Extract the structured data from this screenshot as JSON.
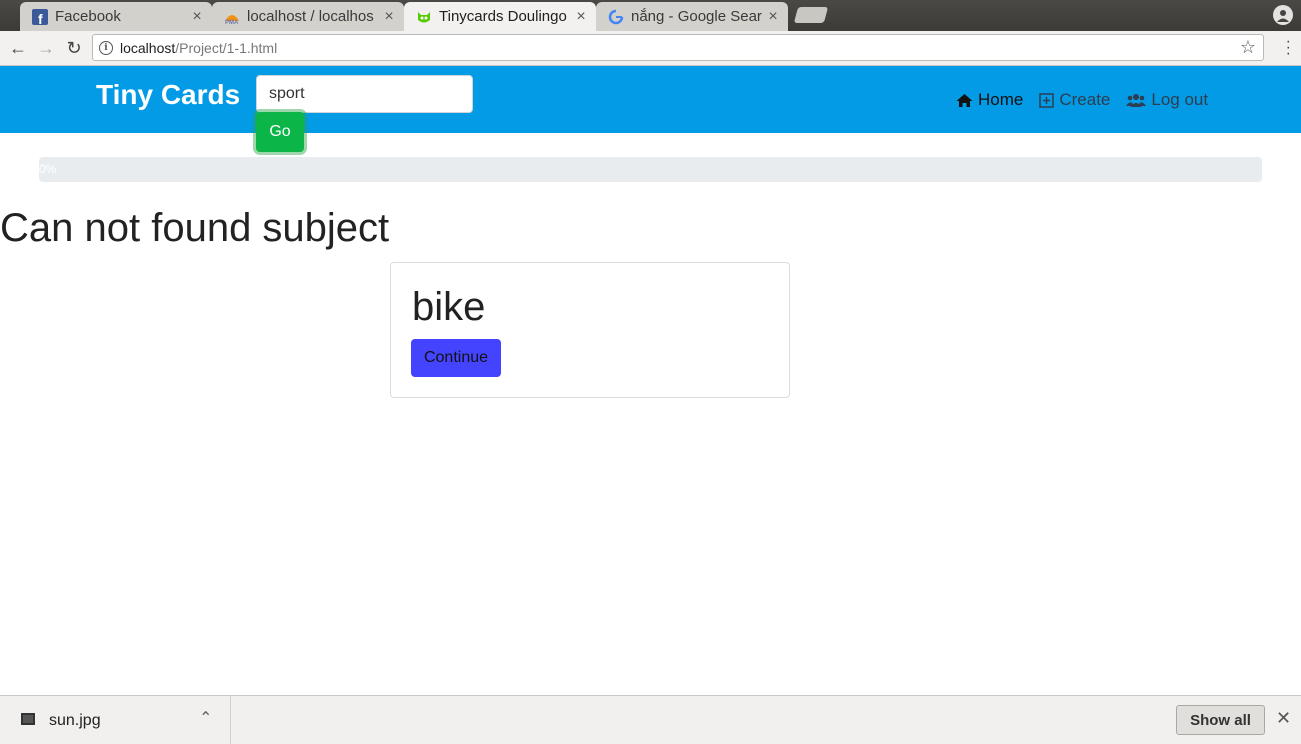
{
  "browser": {
    "tabs": [
      {
        "title": "Facebook",
        "icon": "facebook-icon",
        "active": false
      },
      {
        "title": "localhost / localhos",
        "icon": "phpmyadmin-icon",
        "active": false
      },
      {
        "title": "Tinycards Doulingo",
        "icon": "duolingo-owl-icon",
        "active": true
      },
      {
        "title": "nắng - Google Sear",
        "icon": "google-icon",
        "active": false
      }
    ],
    "close_glyph": "×",
    "url_host": "localhost",
    "url_path": "/Project/1-1.html"
  },
  "navbar": {
    "brand": "Tiny Cards",
    "search_value": "sport",
    "go_label": "Go",
    "links": {
      "home": "Home",
      "create": "Create",
      "logout": "Log out"
    },
    "bg_color": "#039be5"
  },
  "progress": {
    "value": 0,
    "label": "0%"
  },
  "main": {
    "heading": "Can not found subject",
    "card": {
      "word": "bike",
      "button_label": "Continue"
    }
  },
  "downloads": {
    "file_name": "sun.jpg",
    "show_all_label": "Show all"
  }
}
